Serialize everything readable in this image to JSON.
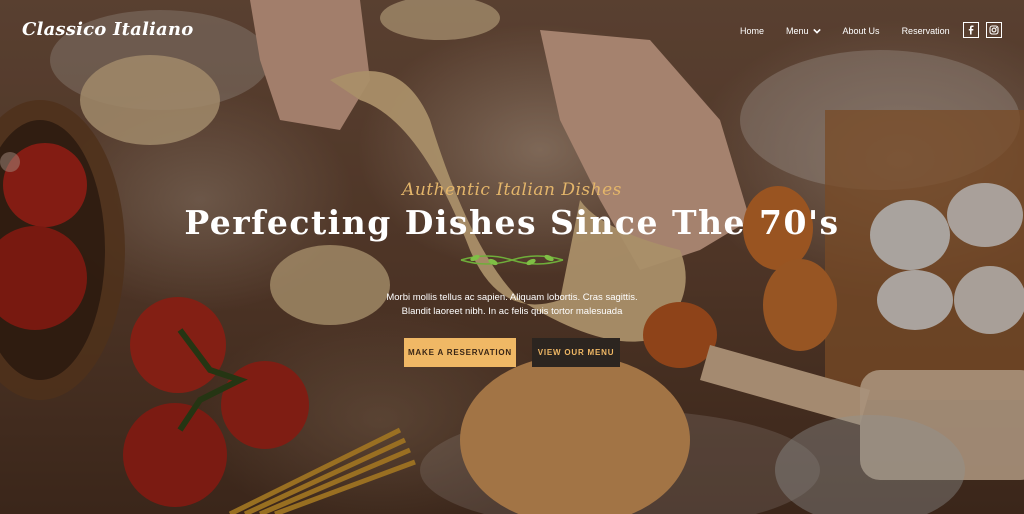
{
  "brand": {
    "logo_text": "Classico Italiano"
  },
  "nav": {
    "items": [
      "Home",
      "Menu",
      "About Us",
      "Reservation"
    ],
    "social": [
      "facebook-icon",
      "instagram-icon"
    ]
  },
  "hero": {
    "tagline": "Authentic Italian Dishes",
    "headline": "Perfecting Dishes Since The 70's",
    "description_line1": "Morbi mollis tellus ac sapien. Aliquam lobortis. Cras sagittis.",
    "description_line2": "Blandit laoreet nibh. In ac felis quis tortor malesuada",
    "primary_button": "MAKE A RESERVATION",
    "secondary_button": "VIEW OUR MENU"
  },
  "colors": {
    "accent": "#f0b865",
    "tagline": "#e3b56a",
    "dark_button": "#2c2520",
    "text": "#ffffff",
    "divider_leaf": "#6fae3a"
  }
}
